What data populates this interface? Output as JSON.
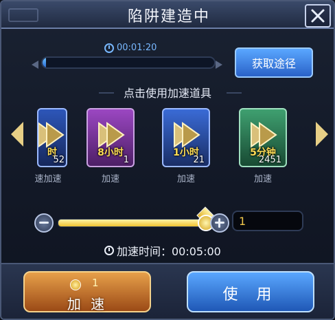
{
  "dialog": {
    "title": "陷阱建造中",
    "close_icon": "close-icon"
  },
  "progress": {
    "timer_text": "00:01:20",
    "fill_fraction": 0.02
  },
  "actions": {
    "acquire_label": "获取途径"
  },
  "accel": {
    "section_title": "点击使用加速道具",
    "items": [
      {
        "duration": "时",
        "count": "52",
        "label": "速加速",
        "variant": "partial",
        "icon": "speedup-icon"
      },
      {
        "duration": "8小时",
        "count": "1",
        "label": "加速",
        "variant": "purple",
        "icon": "speedup-icon"
      },
      {
        "duration": "1小时",
        "count": "21",
        "label": "加速",
        "variant": "blue",
        "icon": "speedup-icon"
      },
      {
        "duration": "5分钟",
        "count": "2451",
        "label": "加速",
        "variant": "green",
        "icon": "speedup-icon"
      }
    ]
  },
  "slider": {
    "value_fraction": 1.0,
    "quantity": "1"
  },
  "speed_time": {
    "text": "加速时间：00:05:00"
  },
  "footer": {
    "speedup_label": "加 速",
    "cost": "1",
    "use_label": "使 用"
  }
}
